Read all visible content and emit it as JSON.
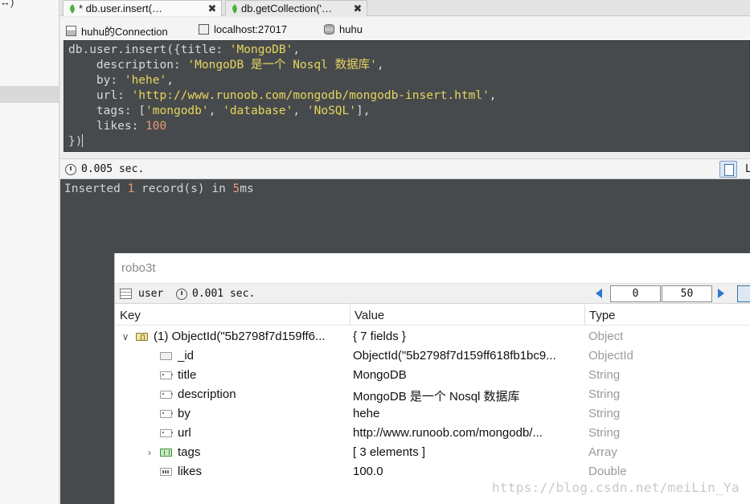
{
  "sidebar": {
    "top_glyph": "↔)"
  },
  "tabs": [
    {
      "label": "* db.user.insert(…",
      "close": "✖",
      "active": true
    },
    {
      "label": "db.getCollection('…",
      "close": "✖",
      "active": false
    }
  ],
  "connection": {
    "name": "huhu的Connection",
    "server": "localhost:27017",
    "database": "huhu"
  },
  "editor": {
    "lines": [
      "db.user.insert({title: 'MongoDB',",
      "    description: 'MongoDB 是一个 Nosql 数据库',",
      "    by: 'hehe',",
      "    url: 'http://www.runoob.com/mongodb/mongodb-insert.html',",
      "    tags: ['mongodb', 'database', 'NoSQL'],",
      "    likes: 100",
      "})"
    ]
  },
  "status": {
    "time": "0.005 sec.",
    "trailing_glyph": "L"
  },
  "output": {
    "message": "Inserted 1 record(s) in 5ms"
  },
  "panel": {
    "title": "robo3t",
    "collection": "user",
    "time": "0.001 sec.",
    "page_start": "0",
    "page_size": "50",
    "columns": {
      "key": "Key",
      "value": "Value",
      "type": "Type"
    },
    "rows": [
      {
        "toggle": "∨",
        "icon": "obj",
        "key": "(1) ObjectId(\"5b2798f7d159ff6...",
        "value": "{ 7 fields }",
        "type": "Object",
        "indent": 0
      },
      {
        "toggle": "",
        "icon": "id",
        "key": "_id",
        "value": "ObjectId(\"5b2798f7d159ff618fb1bc9...",
        "type": "ObjectId",
        "indent": 1
      },
      {
        "toggle": "",
        "icon": "str",
        "key": "title",
        "value": "MongoDB",
        "type": "String",
        "indent": 1
      },
      {
        "toggle": "",
        "icon": "str",
        "key": "description",
        "value": "MongoDB 是一个 Nosql 数据库",
        "type": "String",
        "indent": 1
      },
      {
        "toggle": "",
        "icon": "str",
        "key": "by",
        "value": "hehe",
        "type": "String",
        "indent": 1
      },
      {
        "toggle": "",
        "icon": "str",
        "key": "url",
        "value": "http://www.runoob.com/mongodb/...",
        "type": "String",
        "indent": 1
      },
      {
        "toggle": "›",
        "icon": "arr",
        "key": "tags",
        "value": "[ 3 elements ]",
        "type": "Array",
        "indent": 1
      },
      {
        "toggle": "",
        "icon": "num",
        "key": "likes",
        "value": "100.0",
        "type": "Double",
        "indent": 1
      }
    ]
  },
  "watermark": "https://blog.csdn.net/meiLin_Ya"
}
